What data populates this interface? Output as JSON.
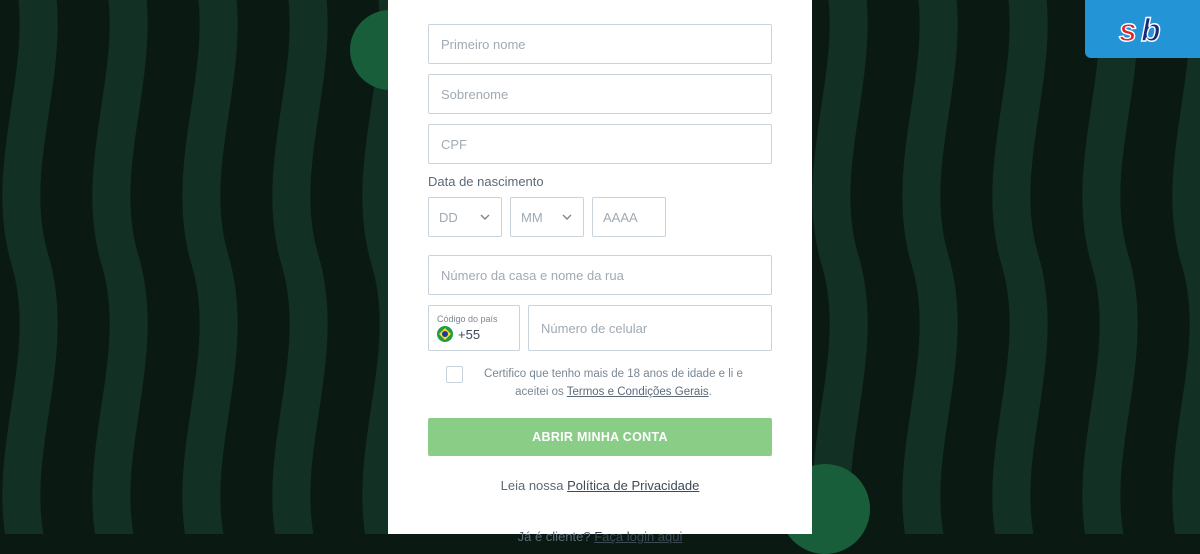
{
  "form": {
    "first_name_placeholder": "Primeiro nome",
    "surname_placeholder": "Sobrenome",
    "cpf_placeholder": "CPF",
    "dob_label": "Data de nascimento",
    "dob_day": "DD",
    "dob_month": "MM",
    "dob_year": "AAAA",
    "address_placeholder": "Número da casa e nome da rua",
    "country_code_label": "Código do país",
    "country_code_value": "+55",
    "phone_placeholder": "Número de celular",
    "cert_text_prefix": "Certifico que tenho mais de 18 anos de idade e li e aceitei os ",
    "cert_link": "Termos e Condições Gerais",
    "cert_suffix": ".",
    "submit_label": "ABRIR MINHA CONTA",
    "privacy_prefix": "Leia nossa ",
    "privacy_link": "Política de Privacidade",
    "login_prefix": "Já é cliente? ",
    "login_link": "Faça login aqui"
  }
}
